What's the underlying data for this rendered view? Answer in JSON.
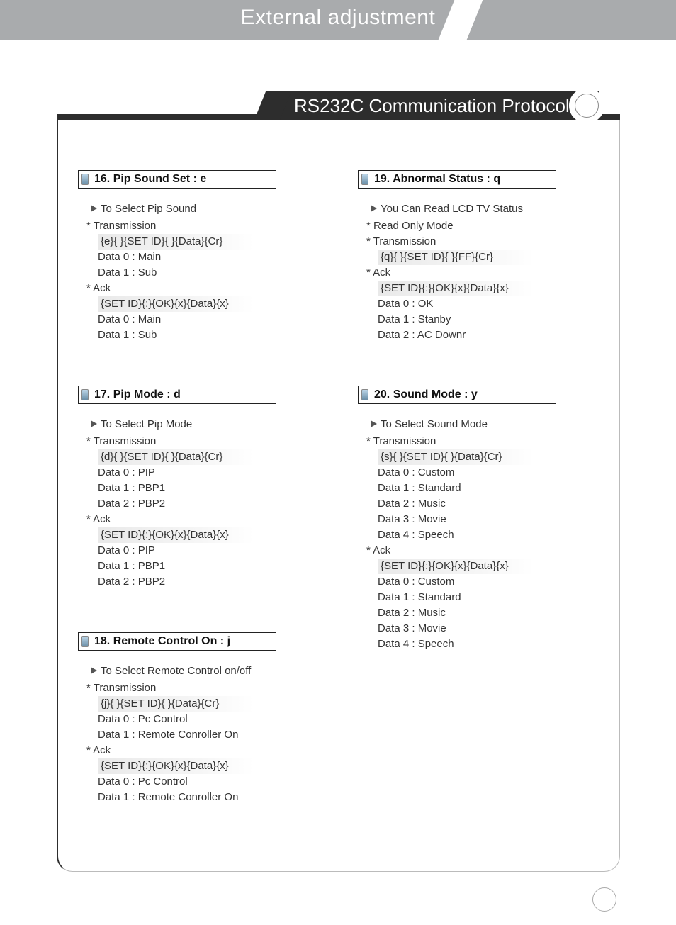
{
  "header": {
    "title": "External adjustment",
    "subtitle": "RS232C Communication Protocol"
  },
  "left": [
    {
      "title": "16. Pip Sound Set : e",
      "lead": "To Select Pip Sound",
      "tx_label": "* Transmission",
      "tx_cmd": "{e}{ }{SET ID}{ }{Data}{Cr}",
      "tx_data": [
        "Data 0 : Main",
        "Data 1 : Sub"
      ],
      "ack_label": "* Ack",
      "ack_cmd": "{SET ID}{:}{OK}{x}{Data}{x}",
      "ack_data": [
        "Data 0 : Main",
        "Data 1 : Sub"
      ]
    },
    {
      "title": "17. Pip Mode : d",
      "lead": "To Select Pip Mode",
      "tx_label": "* Transmission",
      "tx_cmd": "{d}{ }{SET ID}{ }{Data}{Cr}",
      "tx_data": [
        "Data 0 : PIP",
        "Data 1 : PBP1",
        "Data 2 : PBP2"
      ],
      "ack_label": "* Ack",
      "ack_cmd": "{SET ID}{:}{OK}{x}{Data}{x}",
      "ack_data": [
        "Data 0 : PIP",
        "Data 1 : PBP1",
        "Data 2 : PBP2"
      ]
    },
    {
      "title": "18. Remote Control On : j",
      "lead": "To Select Remote Control on/off",
      "tx_label": "* Transmission",
      "tx_cmd": "{j}{ }{SET ID}{ }{Data}{Cr}",
      "tx_data": [
        "Data 0 : Pc Control",
        "Data 1 : Remote Conroller On"
      ],
      "ack_label": "* Ack",
      "ack_cmd": "{SET ID}{:}{OK}{x}{Data}{x}",
      "ack_data": [
        "Data 0 : Pc Control",
        "Data 1 : Remote Conroller On"
      ]
    }
  ],
  "right": [
    {
      "title": "19. Abnormal Status : q",
      "lead": "You Can Read LCD TV Status",
      "note": "* Read Only Mode",
      "tx_label": "* Transmission",
      "tx_cmd": "{q}{ }{SET ID}{ }{FF}{Cr}",
      "tx_data": [],
      "ack_label": "* Ack",
      "ack_cmd": "{SET ID}{:}{OK}{x}{Data}{x}",
      "ack_data": [
        "Data 0 : OK",
        "Data 1 : Stanby",
        "Data 2 : AC Downr"
      ]
    },
    {
      "title": "20. Sound Mode : y",
      "lead": "To Select Sound Mode",
      "tx_label": "* Transmission",
      "tx_cmd": "{s}{ }{SET ID}{ }{Data}{Cr}",
      "tx_data": [
        "Data 0 : Custom",
        "Data 1 : Standard",
        "Data 2 : Music",
        "Data 3 : Movie",
        "Data 4 : Speech"
      ],
      "ack_label": "* Ack",
      "ack_cmd": "{SET ID}{:}{OK}{x}{Data}{x}",
      "ack_data": [
        "Data 0 : Custom",
        "Data 1 : Standard",
        "Data 2 : Music",
        "Data 3 : Movie",
        "Data 4 : Speech"
      ]
    }
  ]
}
